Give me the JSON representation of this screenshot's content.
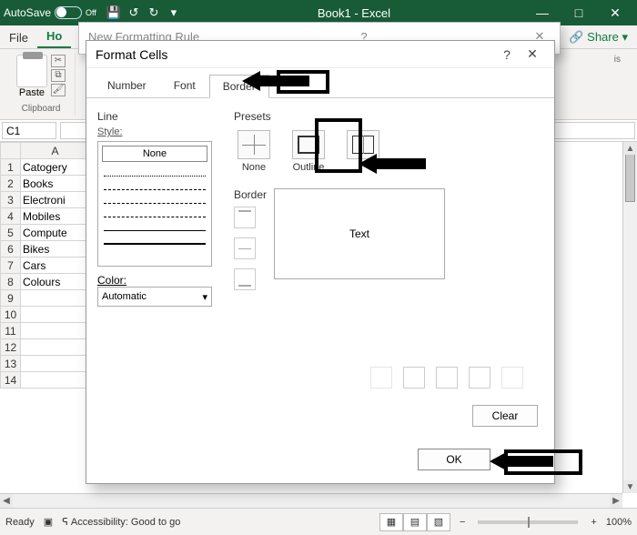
{
  "titlebar": {
    "autosave_label": "AutoSave",
    "autosave_state": "Off",
    "doc_title": "Book1 - Excel",
    "min": "—",
    "max": "□",
    "close": "✕"
  },
  "ribbon": {
    "tabs": {
      "file": "File",
      "home": "Ho",
      "share": "Share"
    },
    "group_clipboard": "Clipboard",
    "paste": "Paste",
    "analysis_group": "is"
  },
  "formula_bar": {
    "namebox": "C1"
  },
  "grid": {
    "col_header": "A",
    "rows": [
      "Catogery",
      "Books",
      "Electroni",
      "Mobiles",
      "Compute",
      "Bikes",
      "Cars",
      "Colours"
    ]
  },
  "parent_dialog": {
    "title": "New Formatting Rule",
    "help": "?",
    "close": "✕"
  },
  "dialog": {
    "title": "Format Cells",
    "help": "?",
    "close": "✕",
    "tabs": {
      "number": "Number",
      "font": "Font",
      "border": "Border"
    },
    "line_section": "Line",
    "style_label": "Style:",
    "style_none": "None",
    "color_label": "Color:",
    "color_value": "Automatic",
    "presets_label": "Presets",
    "preset_none": "None",
    "preset_outline": "Outline",
    "border_label": "Border",
    "preview_text": "Text",
    "clear": "Clear",
    "ok": "OK"
  },
  "status": {
    "ready": "Ready",
    "accessibility": "Accessibility: Good to go",
    "zoom": "100%"
  }
}
